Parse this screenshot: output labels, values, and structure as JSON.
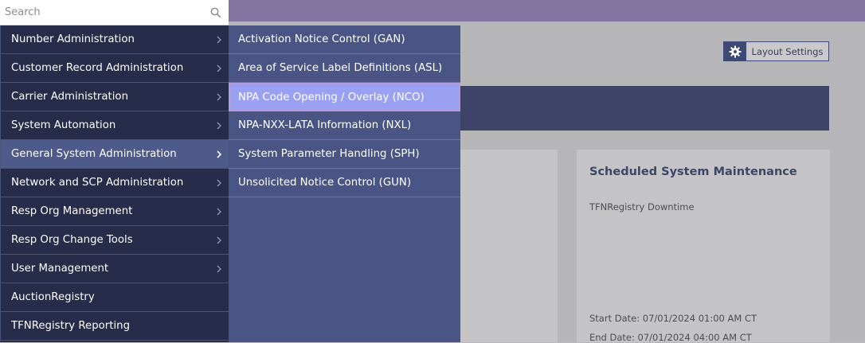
{
  "search": {
    "placeholder": "Search"
  },
  "menu": {
    "items": [
      {
        "label": "Number Administration",
        "has_submenu": true
      },
      {
        "label": "Customer Record Administration",
        "has_submenu": true
      },
      {
        "label": "Carrier Administration",
        "has_submenu": true
      },
      {
        "label": "System Automation",
        "has_submenu": true
      },
      {
        "label": "General System Administration",
        "has_submenu": true,
        "active": true
      },
      {
        "label": "Network and SCP Administration",
        "has_submenu": true
      },
      {
        "label": "Resp Org Management",
        "has_submenu": true
      },
      {
        "label": "Resp Org Change Tools",
        "has_submenu": true
      },
      {
        "label": "User Management",
        "has_submenu": true
      },
      {
        "label": "AuctionRegistry",
        "has_submenu": false
      },
      {
        "label": "TFNRegistry Reporting",
        "has_submenu": false
      }
    ]
  },
  "submenu": {
    "items": [
      {
        "label": "Activation Notice Control (GAN)"
      },
      {
        "label": "Area of Service Label Definitions (ASL)"
      },
      {
        "label": "NPA Code Opening / Overlay (NCO)",
        "highlighted": true
      },
      {
        "label": "NPA-NXX-LATA Information (NXL)"
      },
      {
        "label": "System Parameter Handling (SPH)"
      },
      {
        "label": "Unsolicited Notice Control (GUN)"
      }
    ]
  },
  "header": {
    "layout_settings_label": "Layout Settings"
  },
  "maintenance_card": {
    "title": "Scheduled System Maintenance",
    "subtitle": "TFNRegistry Downtime",
    "start_date": "Start Date:  07/01/2024 01:00 AM CT",
    "end_date": "End Date:  07/01/2024 04:00 AM CT"
  },
  "colors": {
    "menu_bg": "#262c4a",
    "submenu_bg": "#4a5585",
    "active_item": "#4e5a8a",
    "highlight_item": "#9aa0f2",
    "topbar": "#8474a0",
    "card_title": "#3c4567"
  },
  "icons": {
    "search": "search-icon",
    "settings": "gear-icon",
    "submenu_arrow": "chevron-right-icon"
  }
}
